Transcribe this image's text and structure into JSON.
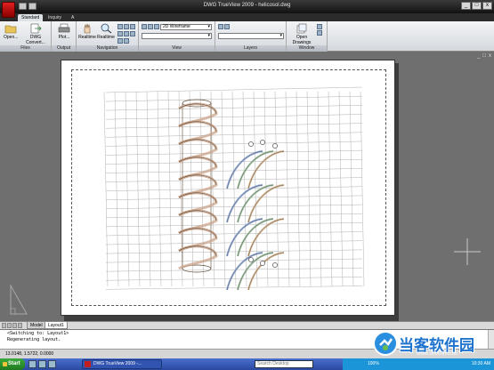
{
  "window": {
    "title": "DWG TrueView 2009 - helicosol.dwg",
    "logo_text": "",
    "controls": [
      "_",
      "□",
      "x"
    ]
  },
  "ribbon_tabs": [
    "Standard",
    "Inquiry",
    "A"
  ],
  "ribbon": {
    "files": {
      "label": "Files",
      "open": "Open...",
      "dwg_convert": "DWG Convert..."
    },
    "output": {
      "label": "Output",
      "plot": "Plot..."
    },
    "navigation": {
      "label": "Navigation",
      "realtime": "Realtime",
      "realtime2": "Realtime"
    },
    "view": {
      "label": "View",
      "visual_style": "2D Wireframe",
      "layer_dropdown": ""
    },
    "layers": {
      "label": "Layers",
      "layer_dropdown": ""
    },
    "window_panel": {
      "label": "Window",
      "open_drawings": "Open Drawings"
    }
  },
  "viewport": {
    "controls": [
      "_",
      "□",
      "x"
    ]
  },
  "layout_tabs": [
    "Model",
    "Layout1"
  ],
  "active_layout": "Layout1",
  "command_history": [
    "<Switching to: Layout1>",
    "Regenerating layout."
  ],
  "status_bar": {
    "coords": "13.0148, 1.5722, 0.0000"
  },
  "taskbar": {
    "start": "Start",
    "task": "DWG TrueView 2009 -...",
    "search_placeholder": "Search Desktop",
    "battery": "100%",
    "time": "10:30 AM"
  },
  "watermark": {
    "brand": "当客软件园",
    "url": "www.downkr.com"
  },
  "drawing": {
    "grid_color": "#b0b0b0",
    "helix_color": "#5a4630",
    "spring_colors": [
      "#8fa8d6",
      "#9ec09e",
      "#d6b48c"
    ]
  }
}
